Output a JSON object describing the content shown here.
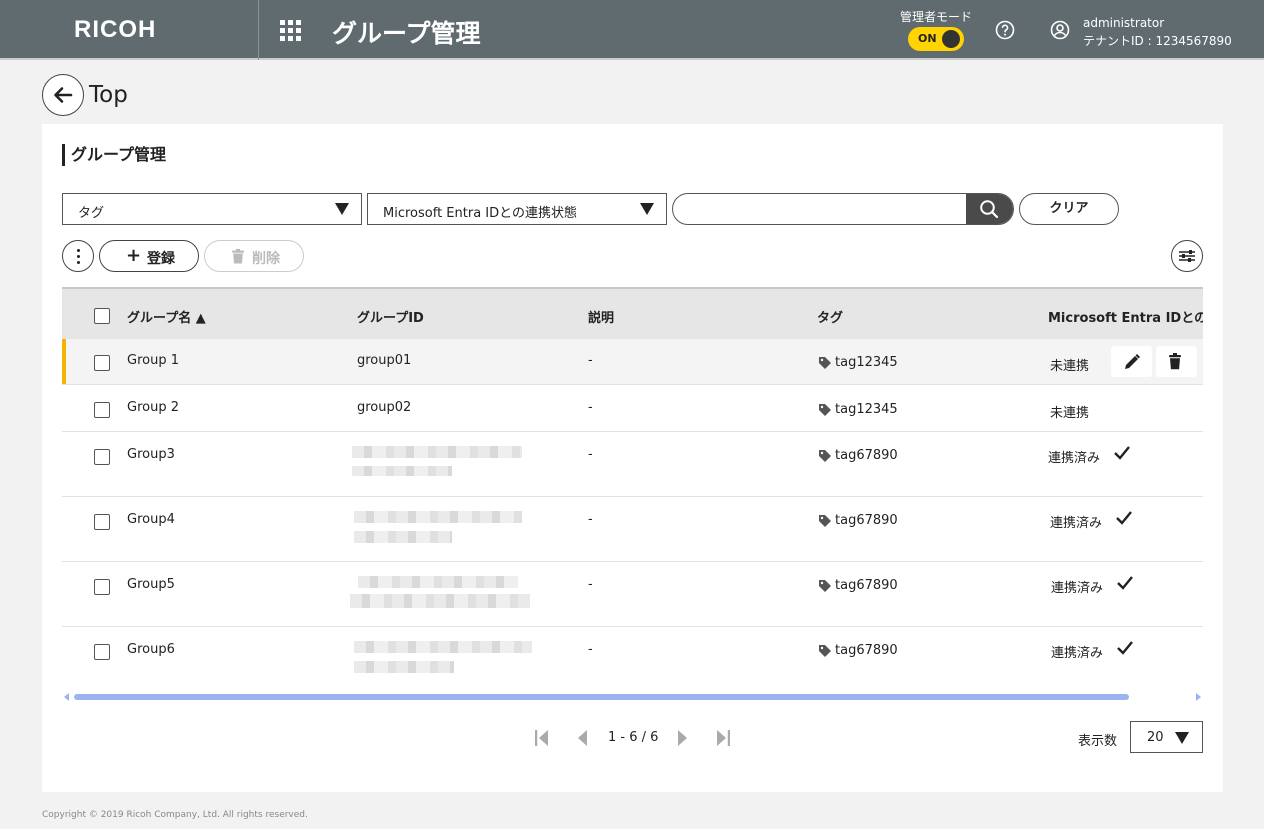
{
  "header": {
    "logo": "RICOH",
    "title": "グループ管理",
    "admin_mode_label": "管理者モード",
    "admin_mode_toggle": "ON",
    "user_name": "administrator",
    "tenant_id": "テナントID : 1234567890"
  },
  "nav": {
    "back_label": "Top"
  },
  "panel": {
    "title": "グループ管理",
    "filters": {
      "tag_select": "タグ",
      "entra_select": "Microsoft Entra IDとの連携状態",
      "search_value": "",
      "clear_label": "クリア"
    },
    "toolbar": {
      "add_label": "登録",
      "delete_label": "削除"
    },
    "table": {
      "columns": [
        "グループ名 ▲",
        "グループID",
        "説明",
        "タグ",
        "Microsoft Entra IDとの連携状態"
      ],
      "rows": [
        {
          "name": "Group 1",
          "id": "group01",
          "description": "-",
          "tag": "tag12345",
          "status": "未連携",
          "linked": false
        },
        {
          "name": "Group 2",
          "id": "group02",
          "description": "-",
          "tag": "tag12345",
          "status": "未連携",
          "linked": false
        },
        {
          "name": "Group3",
          "id": "",
          "description": "-",
          "tag": "tag67890",
          "status": "連携済み",
          "linked": true
        },
        {
          "name": "Group4",
          "id": "",
          "description": "-",
          "tag": "tag67890",
          "status": "連携済み",
          "linked": true
        },
        {
          "name": "Group5",
          "id": "",
          "description": "-",
          "tag": "tag67890",
          "status": "連携済み",
          "linked": true
        },
        {
          "name": "Group6",
          "id": "",
          "description": "-",
          "tag": "tag67890",
          "status": "連携済み",
          "linked": true
        }
      ]
    },
    "pagination": {
      "info": "1 - 6 / 6",
      "per_page_label": "表示数",
      "per_page_value": "20"
    }
  },
  "footer": {
    "copyright": "Copyright © 2019 Ricoh Company, Ltd. All rights reserved."
  },
  "colors": {
    "header_bg": "#5f6b6e",
    "accent": "#f5b400",
    "toggle": "#ffd400",
    "scrollbar": "#9bb3ee"
  }
}
